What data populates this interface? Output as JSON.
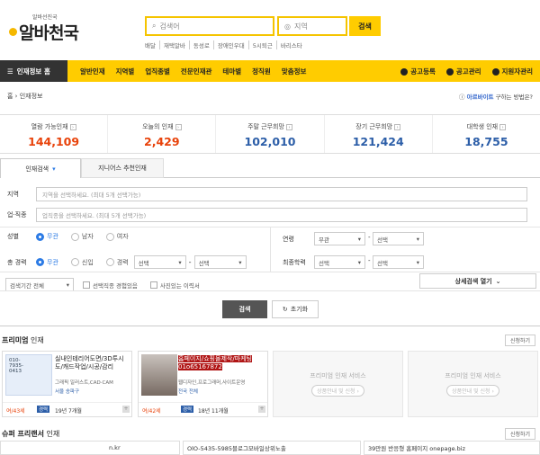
{
  "header": {
    "logo_sub": "알바선진국",
    "logo": "알바천국",
    "search_placeholder": "검색어",
    "region_placeholder": "지역",
    "search_button": "검색",
    "quick_links": [
      "배달",
      "재택알바",
      "동성로",
      "장애인우대",
      "5시퇴근",
      "바리스타"
    ]
  },
  "nav": {
    "home": "인재정보 홈",
    "items": [
      "알반인재",
      "지역별",
      "업직종별",
      "전문인재관",
      "테마별",
      "정직원",
      "맞춤정보"
    ],
    "right": [
      "공고등록",
      "공고관리",
      "지원자관리"
    ]
  },
  "breadcrumb": "홈 › 인재정보",
  "hint": {
    "strong": "아르바이트",
    "text": " 구하는 방법은?"
  },
  "stats": [
    {
      "label": "열람 가능인재",
      "value": "144,109",
      "red": true
    },
    {
      "label": "오늘의 인재",
      "value": "2,429",
      "red": true
    },
    {
      "label": "주말 근무희망",
      "value": "102,010",
      "red": false
    },
    {
      "label": "장기 근무희망",
      "value": "121,424",
      "red": false
    },
    {
      "label": "대학생 인재",
      "value": "18,755",
      "red": false
    }
  ],
  "tabs": {
    "search": "인재검색",
    "recommend": "지니어스 추천인재"
  },
  "form": {
    "region_label": "지역",
    "region_placeholder": "지역을 선택하세요. (최대 5개 선택가능)",
    "job_label": "업·직종",
    "job_placeholder": "업직종을 선택하세요. (최대 5개 선택가능)",
    "gender_label": "성별",
    "gender_options": [
      "무관",
      "남자",
      "여자"
    ],
    "age_label": "연령",
    "age_from": "무관",
    "age_to": "선택",
    "career_label": "총 경력",
    "career_options": [
      "무관",
      "신입",
      "경력"
    ],
    "career_from": "선택",
    "career_to": "선택",
    "edu_label": "최종학력",
    "edu_from": "선택",
    "edu_to": "선택",
    "period": "검색기간 전체",
    "check1": "선택직종 경험있음",
    "check2": "사진있는 이력서",
    "detail": "상세검색 열기",
    "search_btn": "검색",
    "reset_btn": "초기화"
  },
  "premium": {
    "title_bold": "프리미엄",
    "title_rest": " 인재",
    "apply": "신청하기",
    "card1": {
      "title": "실내인테리어도면/3D투시도/캐드작업/시공/감리",
      "sub": "그래픽 일러스트,CAD·CAM",
      "loc": "서울 송파구",
      "age": "여/43세",
      "career": "경력",
      "career_val": "19년 7개월"
    },
    "card2": {
      "title": "홈페이지/쇼핑몰제작/마케팅 01o65167872",
      "sub": "웹디자인,프로그래머,사이트운영",
      "loc": "전국 전체",
      "age": "여/42세",
      "career": "경력",
      "career_val": "18년 11개월"
    },
    "empty_title": "프리미엄 인재 서비스",
    "empty_btn": "상품안내 및 신청 ›"
  },
  "super": {
    "title_bold": "슈퍼 프리랜서",
    "title_rest": " 인재",
    "apply": "신청하기",
    "rows": [
      "n.kr",
      "OlO-5435-5985블로그모바일상위노출",
      "39만원 반응형 홈페이지 onepage.biz"
    ]
  }
}
